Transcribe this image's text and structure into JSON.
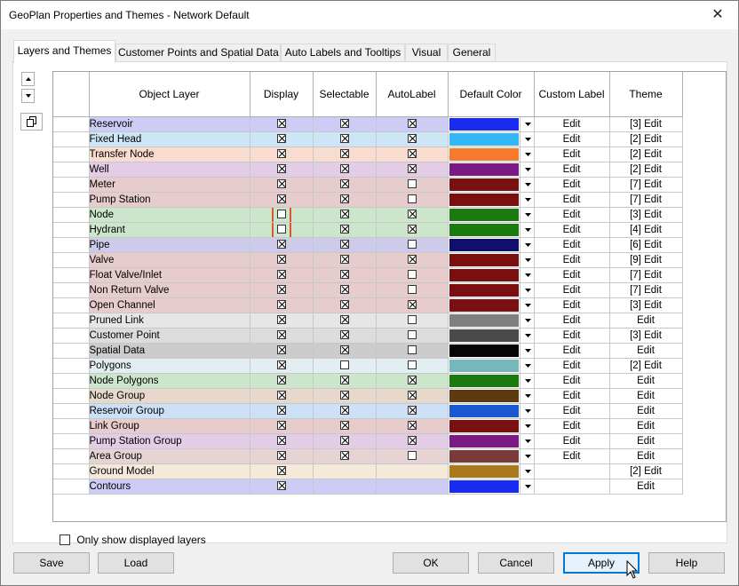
{
  "window": {
    "title": "GeoPlan Properties and Themes - Network Default",
    "close_glyph": "✕"
  },
  "tabs": [
    {
      "label": "Layers and Themes",
      "active": true
    },
    {
      "label": "Customer Points and Spatial Data",
      "active": false
    },
    {
      "label": "Auto Labels and Tooltips",
      "active": false
    },
    {
      "label": "Visual",
      "active": false
    },
    {
      "label": "General",
      "active": false
    }
  ],
  "table": {
    "headers": [
      "Object Layer",
      "Display",
      "Selectable",
      "AutoLabel",
      "Default Color",
      "Custom Label",
      "Theme"
    ],
    "rows": [
      {
        "layer": "Reservoir",
        "bg": "#ccccf5",
        "display": true,
        "selectable": true,
        "autolabel": true,
        "color": "#1a2bf0",
        "custom_label": "Edit",
        "theme": "[3] Edit"
      },
      {
        "layer": "Fixed Head",
        "bg": "#cce6f7",
        "display": true,
        "selectable": true,
        "autolabel": true,
        "color": "#35b6f5",
        "custom_label": "Edit",
        "theme": "[2] Edit"
      },
      {
        "layer": "Transfer Node",
        "bg": "#f7dccf",
        "display": true,
        "selectable": true,
        "autolabel": true,
        "color": "#f57a2e",
        "custom_label": "Edit",
        "theme": "[2] Edit"
      },
      {
        "layer": "Well",
        "bg": "#e2cce6",
        "display": true,
        "selectable": true,
        "autolabel": true,
        "color": "#7a1a82",
        "custom_label": "Edit",
        "theme": "[2] Edit"
      },
      {
        "layer": "Meter",
        "bg": "#e6cccc",
        "display": true,
        "selectable": true,
        "autolabel": false,
        "color": "#7a0f0f",
        "custom_label": "Edit",
        "theme": "[7] Edit"
      },
      {
        "layer": "Pump Station",
        "bg": "#e6cccc",
        "display": true,
        "selectable": true,
        "autolabel": false,
        "color": "#7a0f0f",
        "custom_label": "Edit",
        "theme": "[7] Edit"
      },
      {
        "layer": "Node",
        "bg": "#cce6cc",
        "display": false,
        "selectable": true,
        "autolabel": true,
        "color": "#1a7a0f",
        "custom_label": "Edit",
        "theme": "[3] Edit",
        "highlight_display": true
      },
      {
        "layer": "Hydrant",
        "bg": "#cce6cc",
        "display": false,
        "selectable": true,
        "autolabel": true,
        "color": "#1a7a0f",
        "custom_label": "Edit",
        "theme": "[4] Edit",
        "highlight_display": true
      },
      {
        "layer": "Pipe",
        "bg": "#ccccea",
        "display": true,
        "selectable": true,
        "autolabel": false,
        "color": "#0f0f6e",
        "custom_label": "Edit",
        "theme": "[6] Edit"
      },
      {
        "layer": "Valve",
        "bg": "#e6cccc",
        "display": true,
        "selectable": true,
        "autolabel": true,
        "color": "#7a0f0f",
        "custom_label": "Edit",
        "theme": "[9] Edit"
      },
      {
        "layer": "Float Valve/Inlet",
        "bg": "#e6cccc",
        "display": true,
        "selectable": true,
        "autolabel": false,
        "color": "#7a0f0f",
        "custom_label": "Edit",
        "theme": "[7] Edit"
      },
      {
        "layer": "Non Return Valve",
        "bg": "#e6cccc",
        "display": true,
        "selectable": true,
        "autolabel": false,
        "color": "#7a0f0f",
        "custom_label": "Edit",
        "theme": "[7] Edit"
      },
      {
        "layer": "Open Channel",
        "bg": "#e6cccc",
        "display": true,
        "selectable": true,
        "autolabel": true,
        "color": "#7a0f0f",
        "custom_label": "Edit",
        "theme": "[3] Edit"
      },
      {
        "layer": "Pruned Link",
        "bg": "#e6e6e6",
        "display": true,
        "selectable": true,
        "autolabel": false,
        "color": "#808080",
        "custom_label": "Edit",
        "theme": "Edit"
      },
      {
        "layer": "Customer Point",
        "bg": "#dcdcdc",
        "display": true,
        "selectable": true,
        "autolabel": false,
        "color": "#4a4a4a",
        "custom_label": "Edit",
        "theme": "[3] Edit"
      },
      {
        "layer": "Spatial Data",
        "bg": "#cccccc",
        "display": true,
        "selectable": true,
        "autolabel": false,
        "color": "#050505",
        "custom_label": "Edit",
        "theme": "Edit"
      },
      {
        "layer": "Polygons",
        "bg": "#e2eef2",
        "display": true,
        "selectable": false,
        "autolabel": false,
        "color": "#74b8bb",
        "custom_label": "Edit",
        "theme": "[2] Edit"
      },
      {
        "layer": "Node Polygons",
        "bg": "#cce6cc",
        "display": true,
        "selectable": true,
        "autolabel": true,
        "color": "#1a7a0f",
        "custom_label": "Edit",
        "theme": "Edit"
      },
      {
        "layer": "Node Group",
        "bg": "#e6d9cc",
        "display": true,
        "selectable": true,
        "autolabel": true,
        "color": "#5e3a0f",
        "custom_label": "Edit",
        "theme": "Edit"
      },
      {
        "layer": "Reservoir Group",
        "bg": "#cce0f7",
        "display": true,
        "selectable": true,
        "autolabel": true,
        "color": "#1a5ad0",
        "custom_label": "Edit",
        "theme": "Edit"
      },
      {
        "layer": "Link Group",
        "bg": "#e6cccc",
        "display": true,
        "selectable": true,
        "autolabel": true,
        "color": "#7a0f0f",
        "custom_label": "Edit",
        "theme": "Edit"
      },
      {
        "layer": "Pump Station Group",
        "bg": "#e2cce6",
        "display": true,
        "selectable": true,
        "autolabel": true,
        "color": "#7a1a82",
        "custom_label": "Edit",
        "theme": "Edit"
      },
      {
        "layer": "Area Group",
        "bg": "#e6d4d4",
        "display": true,
        "selectable": true,
        "autolabel": false,
        "color": "#7a3a3a",
        "custom_label": "Edit",
        "theme": "Edit"
      },
      {
        "layer": "Ground Model",
        "bg": "#f5ead9",
        "display": true,
        "selectable": null,
        "autolabel": null,
        "color": "#a8781a",
        "custom_label": "",
        "theme": "[2] Edit"
      },
      {
        "layer": "Contours",
        "bg": "#ccccf5",
        "display": true,
        "selectable": null,
        "autolabel": null,
        "color": "#1a2bf0",
        "custom_label": "",
        "theme": "Edit"
      }
    ]
  },
  "only_show_displayed": {
    "label": "Only show displayed layers",
    "checked": false
  },
  "buttons": {
    "save": "Save",
    "load": "Load",
    "ok": "OK",
    "cancel": "Cancel",
    "apply": "Apply",
    "help": "Help"
  },
  "icons": {
    "spin_up": "up-arrow-icon",
    "spin_down": "down-arrow-icon",
    "copy": "copy-icon",
    "dropdown": "chevron-down-icon",
    "cursor": "mouse-pointer-icon"
  }
}
